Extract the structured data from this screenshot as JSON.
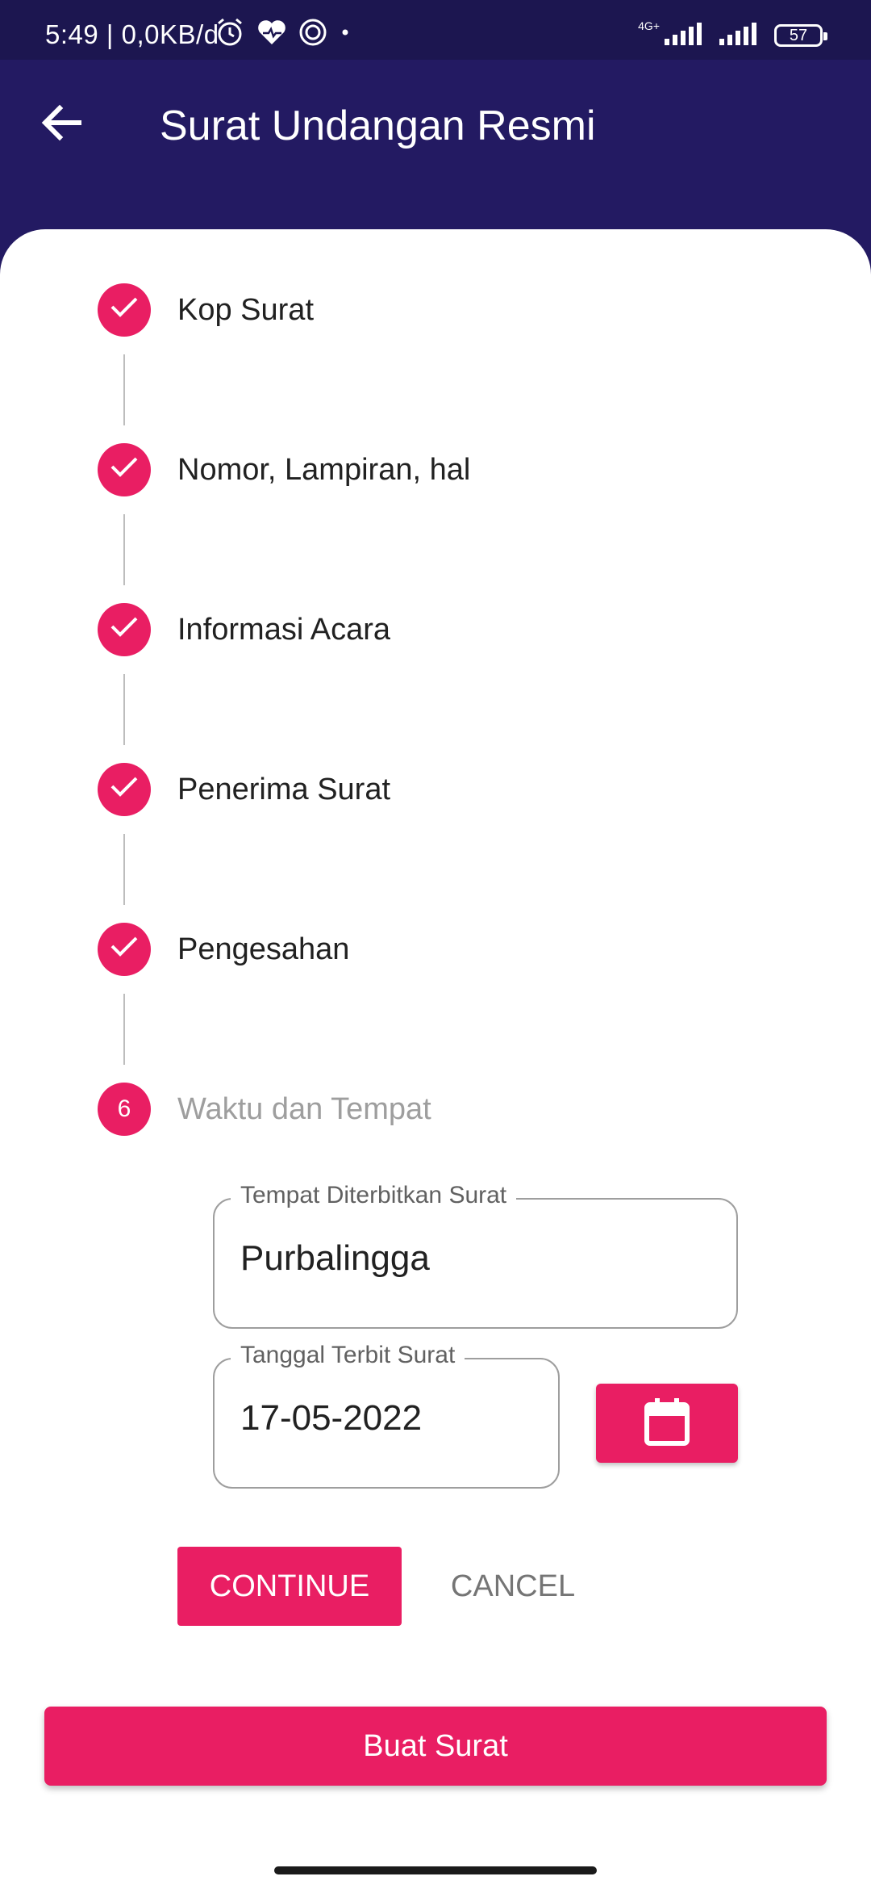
{
  "status_bar": {
    "time": "5:49 | 0,0KB/d",
    "network": "4G+",
    "battery": "57",
    "icons": [
      "alarm-icon",
      "heart-icon",
      "target-icon",
      "dot-icon",
      "signal-icon",
      "signal-icon",
      "battery-icon"
    ]
  },
  "app_bar": {
    "title": "Surat Undangan Resmi",
    "back_icon": "arrow-left-icon"
  },
  "stepper": {
    "steps": [
      {
        "label": "Kop Surat",
        "state": "done"
      },
      {
        "label": "Nomor, Lampiran, hal",
        "state": "done"
      },
      {
        "label": "Informasi Acara",
        "state": "done"
      },
      {
        "label": "Penerima Surat",
        "state": "done"
      },
      {
        "label": "Pengesahan",
        "state": "done"
      },
      {
        "label": "Waktu dan Tempat",
        "state": "active",
        "number": "6"
      }
    ]
  },
  "form": {
    "place": {
      "label": "Tempat Diterbitkan Surat",
      "value": "Purbalingga"
    },
    "date": {
      "label": "Tanggal Terbit Surat",
      "value": "17-05-2022"
    },
    "calendar_icon": "calendar-icon"
  },
  "actions": {
    "continue": "CONTINUE",
    "cancel": "CANCEL",
    "submit": "Buat Surat"
  },
  "colors": {
    "primary": "#e91e63",
    "app_bar": "#231a62",
    "status_bar": "#1c1650"
  }
}
